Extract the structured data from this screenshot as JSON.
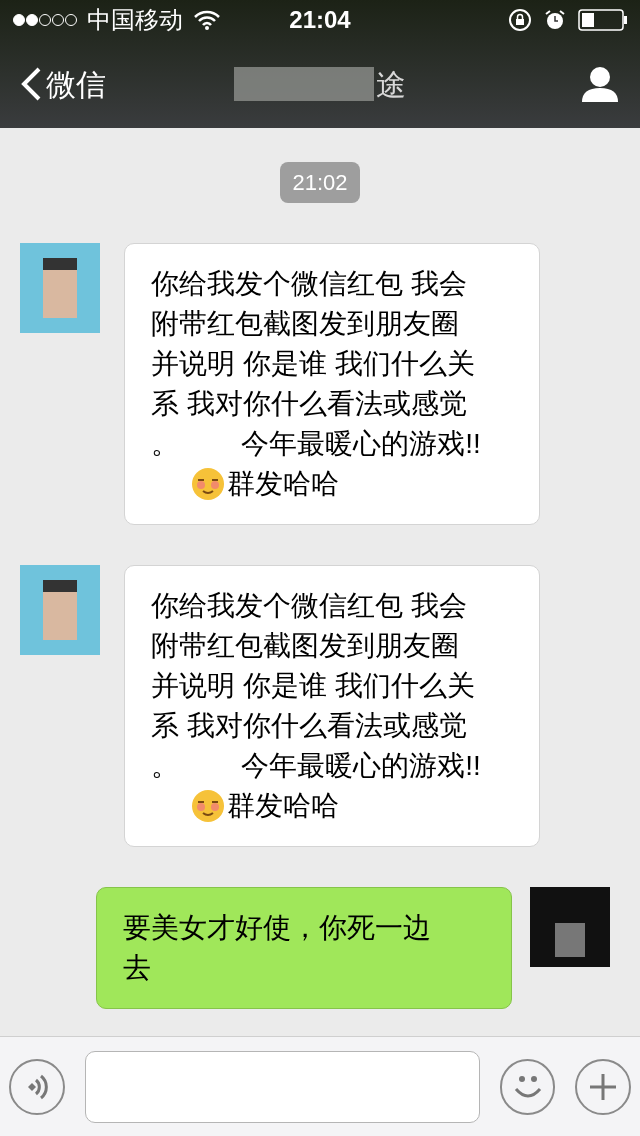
{
  "status_bar": {
    "carrier": "中国移动",
    "time": "21:04"
  },
  "nav_bar": {
    "back_label": "微信",
    "title": "途"
  },
  "timestamp": "21:02",
  "messages": [
    {
      "kind": "incoming",
      "lines": [
        "你给我发个微信红包 我会",
        "附带红包截图发到朋友圈",
        "并说明 你是谁 我们什么关",
        "系 我对你什么看法或感觉",
        "。        今年最暖心的游戏!!"
      ],
      "emoji_text": "群发哈哈"
    },
    {
      "kind": "incoming",
      "lines": [
        "你给我发个微信红包 我会",
        "附带红包截图发到朋友圈",
        "并说明 你是谁 我们什么关",
        "系 我对你什么看法或感觉",
        "。        今年最暖心的游戏!!"
      ],
      "emoji_text": "群发哈哈"
    },
    {
      "kind": "outgoing",
      "lines": [
        "要美女才好使，你死一边",
        "去"
      ]
    }
  ]
}
